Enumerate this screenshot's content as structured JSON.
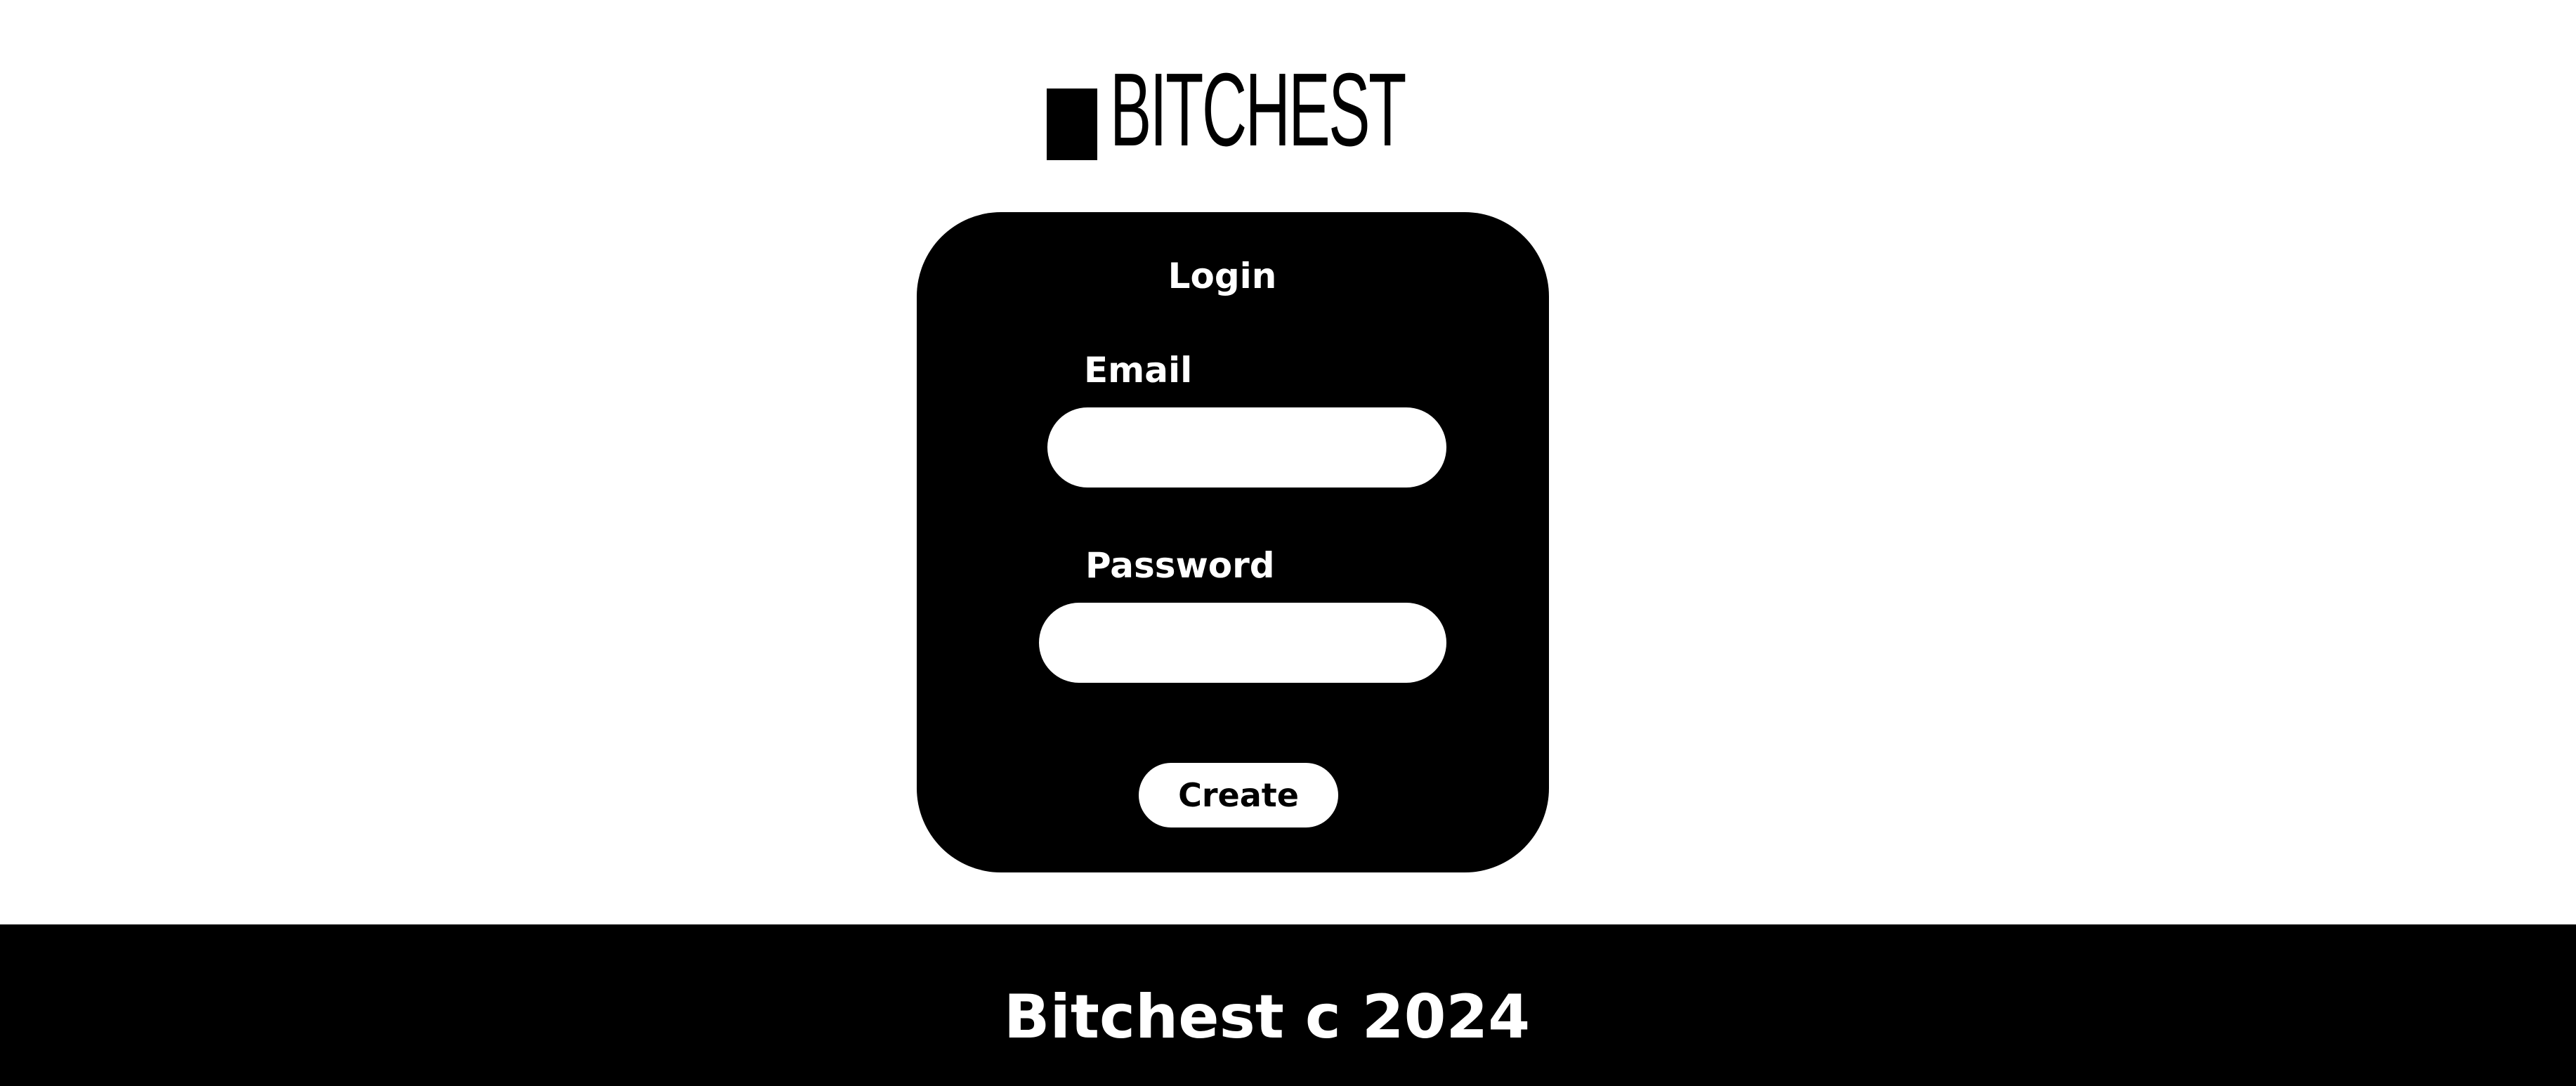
{
  "header": {
    "logo_text": "BITCHEST"
  },
  "login_card": {
    "title": "Login",
    "email_label": "Email",
    "email_value": "",
    "password_label": "Password",
    "password_value": "",
    "submit_label": "Create"
  },
  "footer": {
    "text": "Bitchest c 2024"
  },
  "colors": {
    "background": "#ffffff",
    "card": "#000000",
    "footer": "#000000",
    "text_on_dark": "#ffffff"
  }
}
